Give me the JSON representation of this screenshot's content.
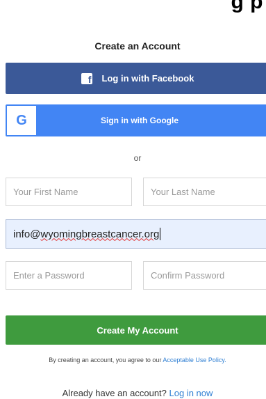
{
  "partial_heading": "g p",
  "form": {
    "title": "Create an Account",
    "facebook_button": "Log in with Facebook",
    "facebook_icon": "f",
    "google_button": "Sign in with Google",
    "google_icon": "G",
    "separator": "or",
    "first_name_placeholder": "Your First Name",
    "last_name_placeholder": "Your Last Name",
    "email_prefix": "info@",
    "email_domain": "wyomingbreastcancer.org",
    "password_placeholder": "Enter a Password",
    "confirm_password_placeholder": "Confirm Password",
    "create_button": "Create My Account",
    "terms_text": "By creating an account, you agree to our ",
    "terms_link": "Acceptable Use Policy.",
    "already_text": "Already have an account? ",
    "login_link": "Log in now"
  },
  "colors": {
    "facebook": "#3b5998",
    "google": "#4285f4",
    "create": "#3f9b3e",
    "link": "#2f7fd3",
    "autofill_bg": "#e8f0fe"
  }
}
